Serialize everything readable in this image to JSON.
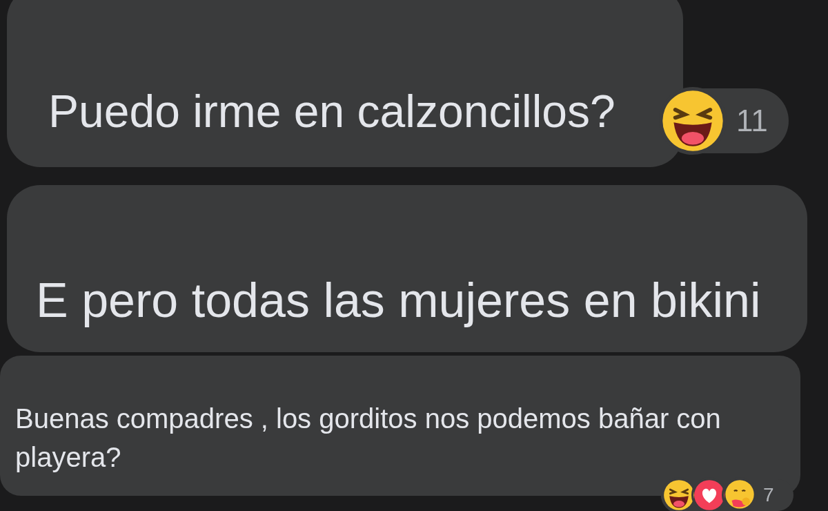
{
  "comments": [
    {
      "text": "Puedo irme en calzoncillos?",
      "reactions": {
        "kinds": [
          {
            "kind": "haha"
          }
        ],
        "count": "11"
      }
    },
    {
      "text": "E pero todas las mujeres en bikini"
    },
    {
      "text": "Buenas compadres , los gorditos nos podemos bañar con playera?",
      "reactions": {
        "kinds": [
          {
            "kind": "haha"
          },
          {
            "kind": "love"
          },
          {
            "kind": "care"
          }
        ],
        "count": "7"
      }
    }
  ]
}
